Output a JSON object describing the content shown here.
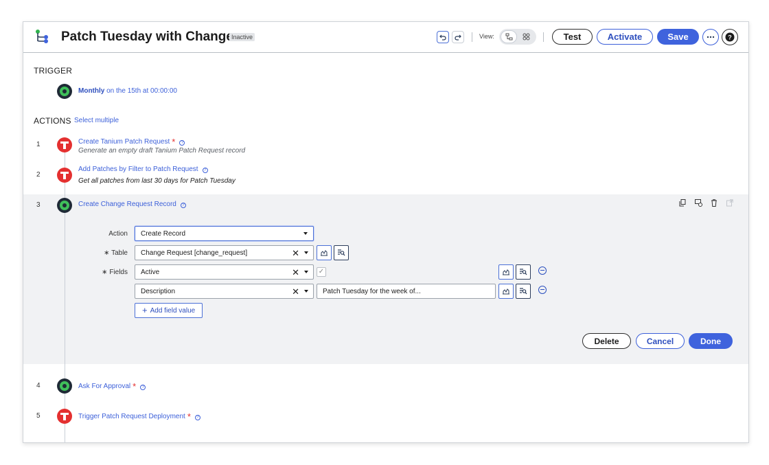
{
  "header": {
    "title": "Patch Tuesday with Change",
    "status_badge": "Inactive",
    "view_label": "View:",
    "test_label": "Test",
    "activate_label": "Activate",
    "save_label": "Save",
    "more_icon": "more-icon",
    "help_icon": "help-icon"
  },
  "trigger": {
    "section_label": "TRIGGER",
    "frequency": "Monthly",
    "detail": " on the 15th at 00:00:00"
  },
  "actions": {
    "section_label": "ACTIONS",
    "select_multiple": "Select multiple",
    "steps": [
      {
        "number": "1",
        "title": "Create Tanium Patch Request",
        "required": "*",
        "description": "Generate an empty draft Tanium Patch Request record"
      },
      {
        "number": "2",
        "title": "Add Patches by Filter to Patch Request",
        "required": "",
        "description": "Get all patches from last 30 days for Patch Tuesday"
      },
      {
        "number": "3",
        "title": "Create Change Request Record",
        "required": "",
        "description": ""
      },
      {
        "number": "4",
        "title": "Ask For Approval",
        "required": "*",
        "description": ""
      },
      {
        "number": "5",
        "title": "Trigger Patch Request Deployment",
        "required": "*",
        "description": ""
      }
    ]
  },
  "editor": {
    "action_label": "Action",
    "action_value": "Create Record",
    "table_label": "∗ Table",
    "table_value": "Change Request [change_request]",
    "fields_label": "∗ Fields",
    "field_rows": [
      {
        "name": "Active",
        "value_check": "✓"
      },
      {
        "name": "Description",
        "value": "Patch Tuesday for the week of..."
      }
    ],
    "add_field_label": "Add field value",
    "delete_label": "Delete",
    "cancel_label": "Cancel",
    "done_label": "Done"
  },
  "colors": {
    "accent": "#3f63dd",
    "required": "#e43030",
    "node_green": "#3fbf5a",
    "node_red": "#e43030"
  }
}
